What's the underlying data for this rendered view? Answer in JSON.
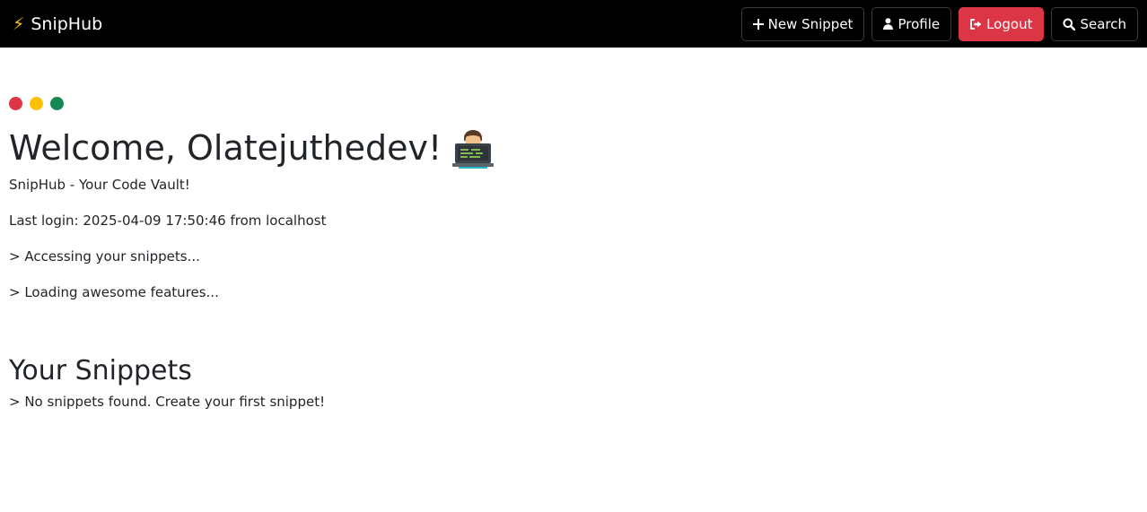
{
  "nav": {
    "brand_icon": "lightning-bolt-icon",
    "brand_label": "SnipHub",
    "new_snippet_label": "New Snippet",
    "profile_label": "Profile",
    "logout_label": "Logout",
    "search_label": "Search"
  },
  "colors": {
    "navbar_bg": "#000000",
    "logout_bg": "#dc3545",
    "dot_red": "#dc3545",
    "dot_yellow": "#ffc107",
    "dot_green": "#198754"
  },
  "main": {
    "welcome_text": "Welcome, Olatejuthedev!",
    "welcome_emoji": "technologist-emoji",
    "subtitle": "SnipHub - Your Code Vault!",
    "last_login": "Last login: 2025-04-09 17:50:46 from localhost",
    "status_lines": [
      "> Accessing your snippets...",
      "> Loading awesome features..."
    ],
    "snippets_heading": "Your Snippets",
    "empty_message": "> No snippets found. Create your first snippet!"
  }
}
